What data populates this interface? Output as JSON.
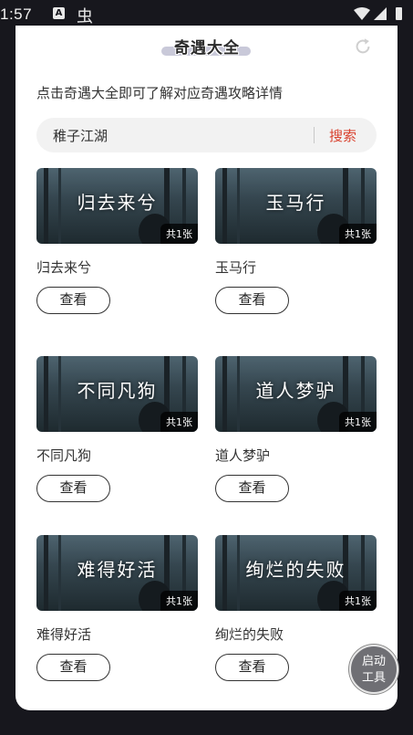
{
  "status": {
    "time": "1:57",
    "a_icon": "A",
    "bug_icon": "虫"
  },
  "header": {
    "title": "奇遇大全"
  },
  "intro": "点击奇遇大全即可了解对应奇遇攻略详情",
  "search": {
    "value": "稚子江湖",
    "button": "搜索"
  },
  "items": [
    {
      "title": "归去来兮",
      "count": "共1张",
      "button": "查看"
    },
    {
      "title": "玉马行",
      "count": "共1张",
      "button": "查看"
    },
    {
      "title": "不同凡狗",
      "count": "共1张",
      "button": "查看"
    },
    {
      "title": "道人梦驴",
      "count": "共1张",
      "button": "查看"
    },
    {
      "title": "难得好活",
      "count": "共1张",
      "button": "查看"
    },
    {
      "title": "绚烂的失败",
      "count": "共1张",
      "button": "查看"
    }
  ],
  "float_tool": {
    "line1": "启动",
    "line2": "工具"
  },
  "colors": {
    "accent": "#d9412e",
    "background": "#17171d",
    "card": "#ffffff"
  }
}
